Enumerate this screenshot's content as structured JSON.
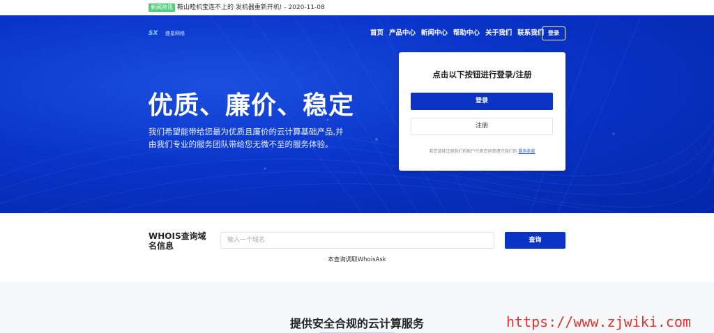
{
  "notice": {
    "badge": "新闻资讯",
    "text": "鞍山睦机宝连不上的 发机器重新开机! - 2020-11-08"
  },
  "header": {
    "logo_mark": "SX",
    "logo_text": "盛星网络",
    "nav": [
      "首页",
      "产品中心",
      "新闻中心",
      "帮助中心",
      "关于我们",
      "联系我们"
    ],
    "login_label": "登录"
  },
  "hero": {
    "title": "优质、廉价、稳定",
    "description": "我们希望能带给您最为优质且廉价的云计算基础产品,并由我们专业的服务团队带给您无微不至的服务体验。"
  },
  "login_card": {
    "title": "点击以下按钮进行登录/注册",
    "login_button": "登录",
    "register_button": "注册",
    "terms_text": "若您选择注册我们的账户代表您同意遵守我们的",
    "terms_link": "服务条款"
  },
  "whois": {
    "label": "WHOIS查询域名信息",
    "placeholder": "输入一个域名",
    "button": "查询",
    "note": "本查询调取WhoisAsk"
  },
  "section": {
    "title": "提供安全合规的云计算服务"
  },
  "watermark": "https://www.zjwiki.com",
  "colors": {
    "primary": "#0c34c4",
    "hero_bg": "#0a34c9",
    "badge": "#4cd07a"
  }
}
